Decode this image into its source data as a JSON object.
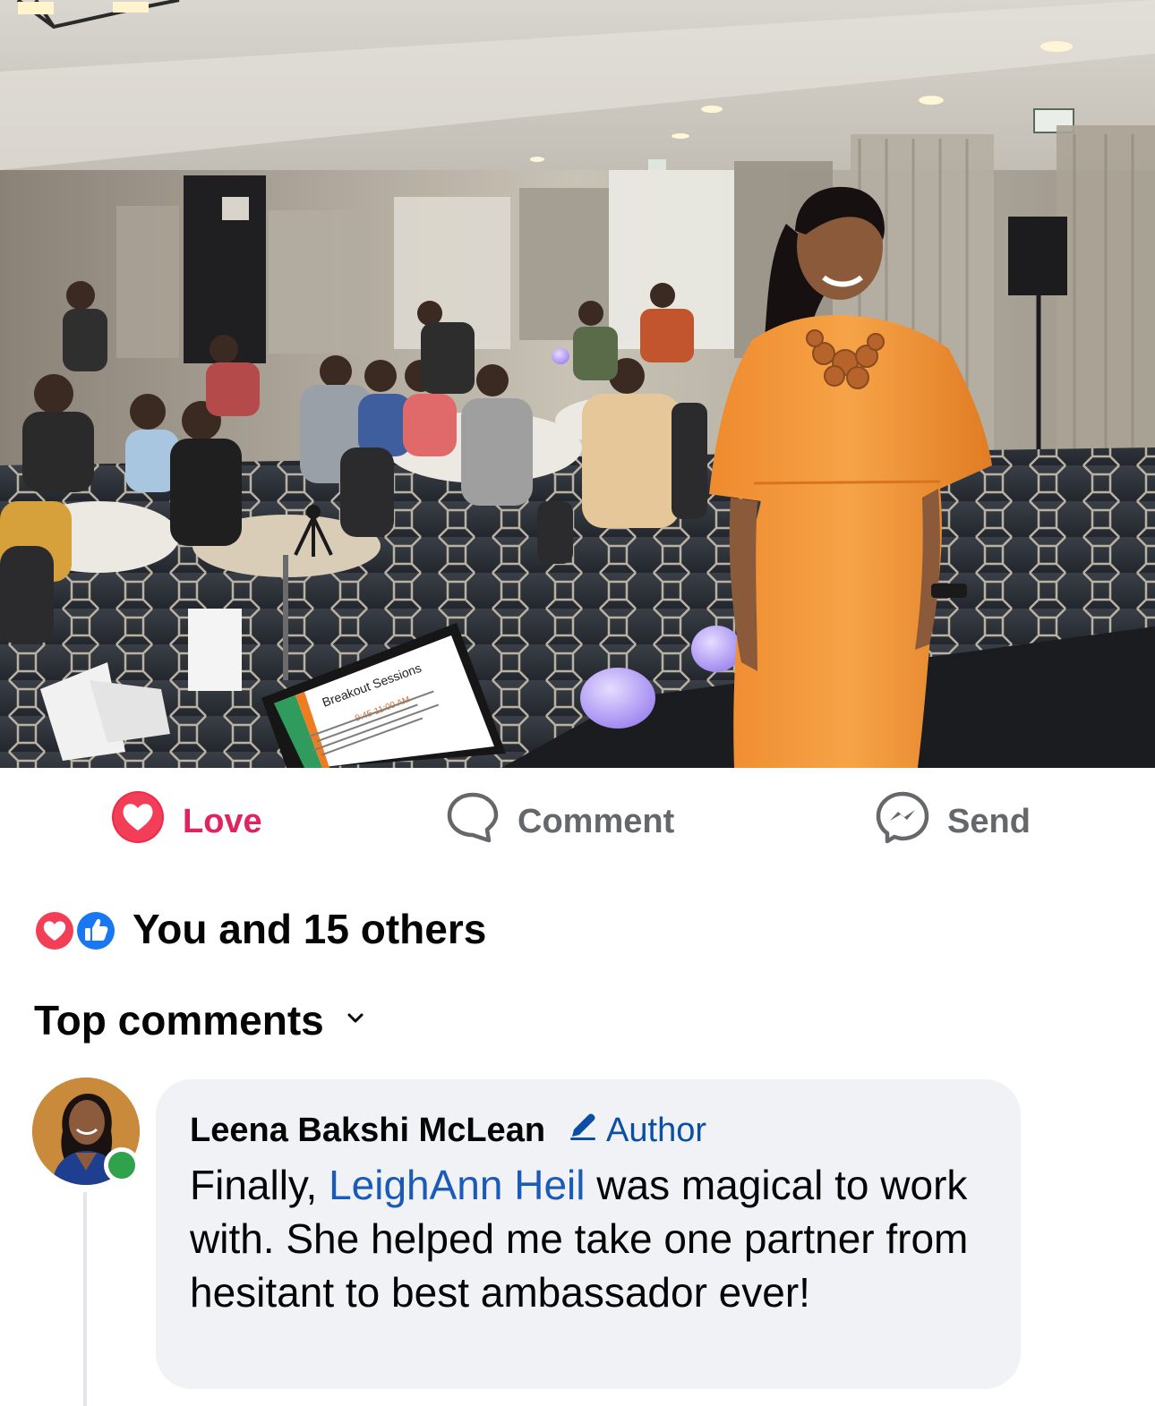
{
  "post": {
    "photo": {
      "screen_title": "Breakout Sessions",
      "screen_time": "9:45-11:00 AM"
    }
  },
  "actions": {
    "love_label": "Love",
    "comment_label": "Comment",
    "send_label": "Send",
    "love_color": "#e0245e",
    "muted_color": "#65676b"
  },
  "reactions": {
    "summary": "You and 15 others",
    "icons": [
      "love-reaction-icon",
      "like-reaction-icon"
    ]
  },
  "comments_section": {
    "sort_label": "Top comments"
  },
  "comment": {
    "author": "Leena Bakshi McLean",
    "badge": "Author",
    "text_before": "Finally, ",
    "mention": "LeighAnn Heil",
    "text_after": " was magical to work with. She helped me take one partner from hesitant to best ambassador ever!",
    "online": true
  }
}
